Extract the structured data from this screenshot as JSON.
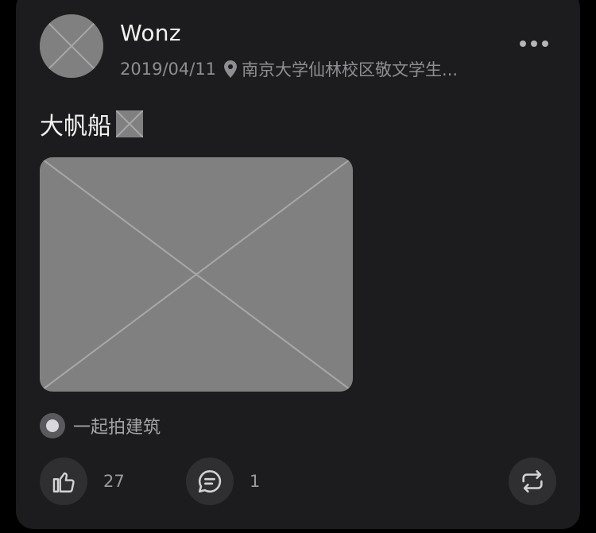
{
  "post": {
    "author": "Wonz",
    "date": "2019/04/11",
    "location": "南京大学仙林校区敬文学生...",
    "text": "大帆船",
    "emoji": "🤔",
    "topic": "一起拍建筑",
    "likes": "27",
    "comments": "1"
  },
  "icons": {
    "more": "more-icon",
    "location": "location-pin-icon",
    "like": "thumbs-up-icon",
    "comment": "comment-icon",
    "repost": "repost-icon",
    "topic": "topic-icon"
  },
  "colors": {
    "background": "#000000",
    "card": "#1c1c1e",
    "text_primary": "#f2f2f2",
    "text_secondary": "#8e8e93",
    "button_bg": "#2f2f32"
  }
}
